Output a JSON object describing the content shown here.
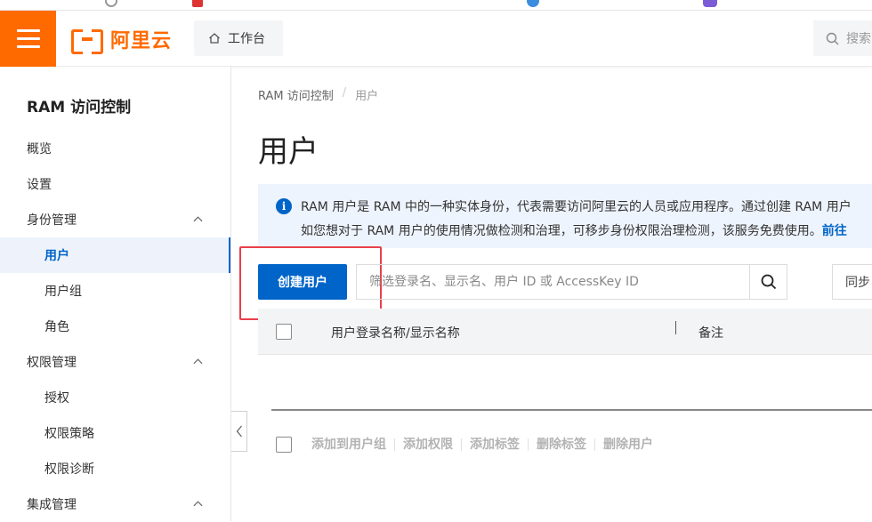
{
  "header": {
    "brand": "阿里云",
    "workbench_label": "工作台",
    "search_placeholder": "搜索"
  },
  "sidebar": {
    "title": "RAM 访问控制",
    "items": [
      {
        "label": "概览"
      },
      {
        "label": "设置"
      },
      {
        "label": "身份管理"
      },
      {
        "label": "用户"
      },
      {
        "label": "用户组"
      },
      {
        "label": "角色"
      },
      {
        "label": "权限管理"
      },
      {
        "label": "授权"
      },
      {
        "label": "权限策略"
      },
      {
        "label": "权限诊断"
      },
      {
        "label": "集成管理"
      }
    ]
  },
  "breadcrumb": {
    "root": "RAM 访问控制",
    "separator": "/",
    "current": "用户"
  },
  "page": {
    "title": "用户"
  },
  "notice": {
    "line1": "RAM 用户是 RAM 中的一种实体身份，代表需要访问阿里云的人员或应用程序。通过创建 RAM 用户",
    "line2": "如您想对于 RAM 用户的使用情况做检测和治理，可移步身份权限治理检测，该服务免费使用。",
    "link": "前往"
  },
  "toolbar": {
    "create_label": "创建用户",
    "search_placeholder": "筛选登录名、显示名、用户 ID 或 AccessKey ID",
    "sync_label": "同步"
  },
  "table": {
    "columns": [
      "用户登录名称/显示名称",
      "备注"
    ]
  },
  "bulk_actions": [
    "添加到用户组",
    "添加权限",
    "添加标签",
    "删除标签",
    "删除用户"
  ],
  "colors": {
    "brand_orange": "#ff6a00",
    "primary_blue": "#0064c8",
    "highlight_red": "#e9404a"
  }
}
